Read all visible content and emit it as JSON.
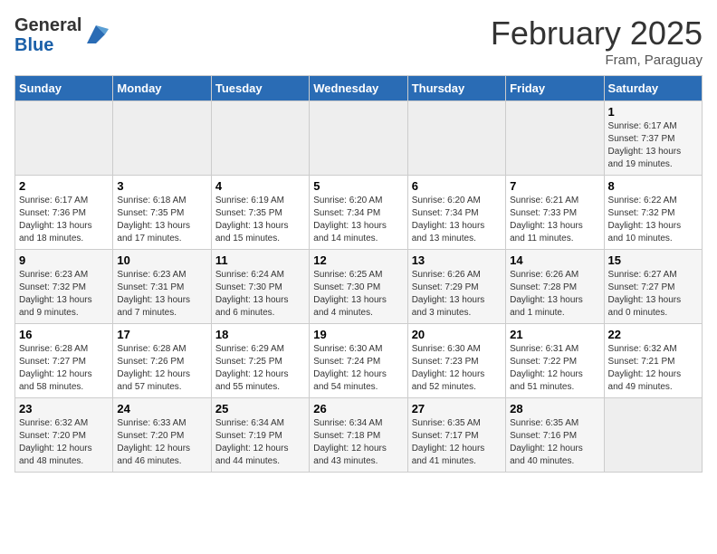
{
  "header": {
    "logo_general": "General",
    "logo_blue": "Blue",
    "month_title": "February 2025",
    "location": "Fram, Paraguay"
  },
  "weekdays": [
    "Sunday",
    "Monday",
    "Tuesday",
    "Wednesday",
    "Thursday",
    "Friday",
    "Saturday"
  ],
  "weeks": [
    [
      {
        "day": "",
        "info": ""
      },
      {
        "day": "",
        "info": ""
      },
      {
        "day": "",
        "info": ""
      },
      {
        "day": "",
        "info": ""
      },
      {
        "day": "",
        "info": ""
      },
      {
        "day": "",
        "info": ""
      },
      {
        "day": "1",
        "info": "Sunrise: 6:17 AM\nSunset: 7:37 PM\nDaylight: 13 hours\nand 19 minutes."
      }
    ],
    [
      {
        "day": "2",
        "info": "Sunrise: 6:17 AM\nSunset: 7:36 PM\nDaylight: 13 hours\nand 18 minutes."
      },
      {
        "day": "3",
        "info": "Sunrise: 6:18 AM\nSunset: 7:35 PM\nDaylight: 13 hours\nand 17 minutes."
      },
      {
        "day": "4",
        "info": "Sunrise: 6:19 AM\nSunset: 7:35 PM\nDaylight: 13 hours\nand 15 minutes."
      },
      {
        "day": "5",
        "info": "Sunrise: 6:20 AM\nSunset: 7:34 PM\nDaylight: 13 hours\nand 14 minutes."
      },
      {
        "day": "6",
        "info": "Sunrise: 6:20 AM\nSunset: 7:34 PM\nDaylight: 13 hours\nand 13 minutes."
      },
      {
        "day": "7",
        "info": "Sunrise: 6:21 AM\nSunset: 7:33 PM\nDaylight: 13 hours\nand 11 minutes."
      },
      {
        "day": "8",
        "info": "Sunrise: 6:22 AM\nSunset: 7:32 PM\nDaylight: 13 hours\nand 10 minutes."
      }
    ],
    [
      {
        "day": "9",
        "info": "Sunrise: 6:23 AM\nSunset: 7:32 PM\nDaylight: 13 hours\nand 9 minutes."
      },
      {
        "day": "10",
        "info": "Sunrise: 6:23 AM\nSunset: 7:31 PM\nDaylight: 13 hours\nand 7 minutes."
      },
      {
        "day": "11",
        "info": "Sunrise: 6:24 AM\nSunset: 7:30 PM\nDaylight: 13 hours\nand 6 minutes."
      },
      {
        "day": "12",
        "info": "Sunrise: 6:25 AM\nSunset: 7:30 PM\nDaylight: 13 hours\nand 4 minutes."
      },
      {
        "day": "13",
        "info": "Sunrise: 6:26 AM\nSunset: 7:29 PM\nDaylight: 13 hours\nand 3 minutes."
      },
      {
        "day": "14",
        "info": "Sunrise: 6:26 AM\nSunset: 7:28 PM\nDaylight: 13 hours\nand 1 minute."
      },
      {
        "day": "15",
        "info": "Sunrise: 6:27 AM\nSunset: 7:27 PM\nDaylight: 13 hours\nand 0 minutes."
      }
    ],
    [
      {
        "day": "16",
        "info": "Sunrise: 6:28 AM\nSunset: 7:27 PM\nDaylight: 12 hours\nand 58 minutes."
      },
      {
        "day": "17",
        "info": "Sunrise: 6:28 AM\nSunset: 7:26 PM\nDaylight: 12 hours\nand 57 minutes."
      },
      {
        "day": "18",
        "info": "Sunrise: 6:29 AM\nSunset: 7:25 PM\nDaylight: 12 hours\nand 55 minutes."
      },
      {
        "day": "19",
        "info": "Sunrise: 6:30 AM\nSunset: 7:24 PM\nDaylight: 12 hours\nand 54 minutes."
      },
      {
        "day": "20",
        "info": "Sunrise: 6:30 AM\nSunset: 7:23 PM\nDaylight: 12 hours\nand 52 minutes."
      },
      {
        "day": "21",
        "info": "Sunrise: 6:31 AM\nSunset: 7:22 PM\nDaylight: 12 hours\nand 51 minutes."
      },
      {
        "day": "22",
        "info": "Sunrise: 6:32 AM\nSunset: 7:21 PM\nDaylight: 12 hours\nand 49 minutes."
      }
    ],
    [
      {
        "day": "23",
        "info": "Sunrise: 6:32 AM\nSunset: 7:20 PM\nDaylight: 12 hours\nand 48 minutes."
      },
      {
        "day": "24",
        "info": "Sunrise: 6:33 AM\nSunset: 7:20 PM\nDaylight: 12 hours\nand 46 minutes."
      },
      {
        "day": "25",
        "info": "Sunrise: 6:34 AM\nSunset: 7:19 PM\nDaylight: 12 hours\nand 44 minutes."
      },
      {
        "day": "26",
        "info": "Sunrise: 6:34 AM\nSunset: 7:18 PM\nDaylight: 12 hours\nand 43 minutes."
      },
      {
        "day": "27",
        "info": "Sunrise: 6:35 AM\nSunset: 7:17 PM\nDaylight: 12 hours\nand 41 minutes."
      },
      {
        "day": "28",
        "info": "Sunrise: 6:35 AM\nSunset: 7:16 PM\nDaylight: 12 hours\nand 40 minutes."
      },
      {
        "day": "",
        "info": ""
      }
    ]
  ]
}
